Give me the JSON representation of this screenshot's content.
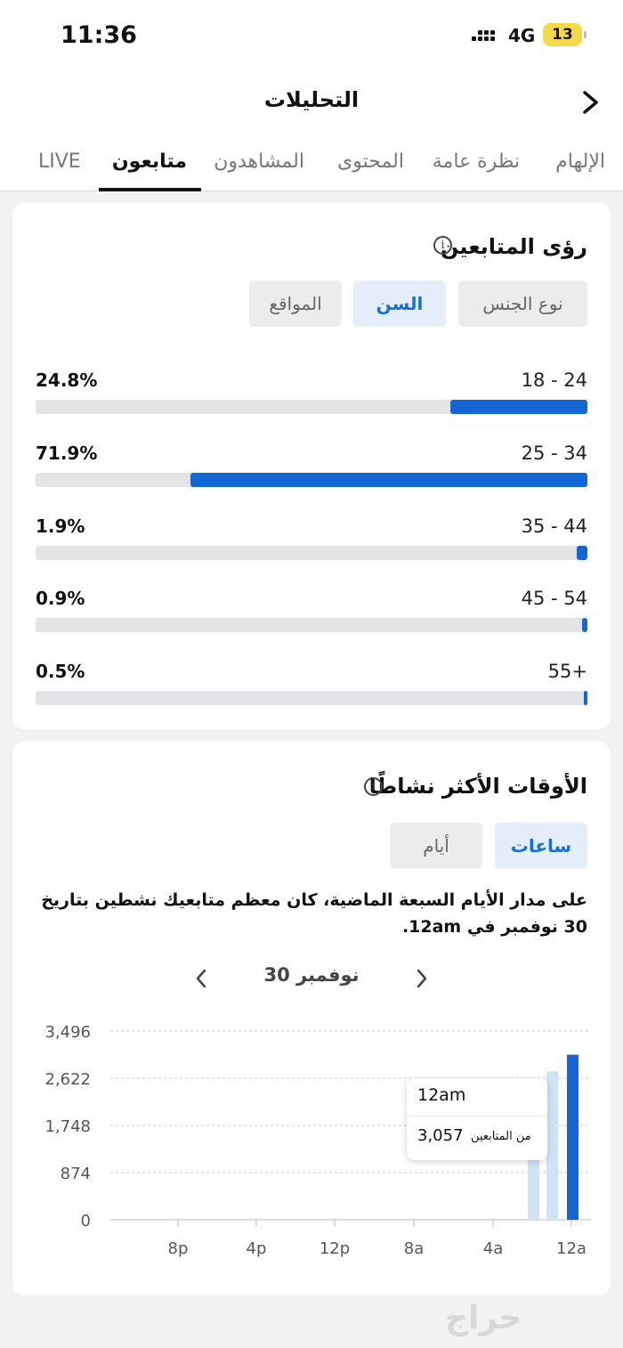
{
  "status_bar": {
    "time": "11:36",
    "network": "4G",
    "battery": "13"
  },
  "header": {
    "title": "التحليلات"
  },
  "tabs": [
    {
      "label": "الإلهام"
    },
    {
      "label": "نظرة عامة"
    },
    {
      "label": "المحتوى"
    },
    {
      "label": "المشاهدون"
    },
    {
      "label": "متابعون",
      "active": true
    },
    {
      "label": "LIVE"
    }
  ],
  "insights": {
    "title": "رؤى المتابعين",
    "info_icon": "i",
    "segments": [
      {
        "label": "نوع الجنس"
      },
      {
        "label": "السن",
        "active": true
      },
      {
        "label": "المواقع"
      }
    ],
    "age_groups": [
      {
        "range": "18 - 24",
        "percent": "24.8%",
        "value": 24.8
      },
      {
        "range": "25 - 34",
        "percent": "71.9%",
        "value": 71.9
      },
      {
        "range": "35 - 44",
        "percent": "1.9%",
        "value": 1.9
      },
      {
        "range": "45 - 54",
        "percent": "0.9%",
        "value": 0.9
      },
      {
        "range": "55+",
        "percent": "0.5%",
        "value": 0.5
      }
    ],
    "bar_color": "#1466d4"
  },
  "active_times": {
    "title": "الأوقات الأكثر نشاطًا",
    "info_icon": "i",
    "segments": [
      {
        "label": "ساعات",
        "active": true
      },
      {
        "label": "أيام"
      }
    ],
    "description": "على مدار الأيام السبعة الماضية، كان معظم متابعيك نشطين بتاريخ 30 نوفمبر في 12am.",
    "date_label": "30 نوفمبر",
    "tooltip": {
      "time": "12am",
      "value": "3,057",
      "label": "من المتابعين"
    }
  },
  "chart_data": {
    "type": "bar",
    "yticks": [
      "3,496",
      "2,622",
      "1,748",
      "874",
      "0"
    ],
    "ylim": [
      0,
      3496
    ],
    "xticks": [
      "8p",
      "4p",
      "12p",
      "8a",
      "4a",
      "12a"
    ],
    "bars": [
      {
        "value": 1150,
        "highlight": false
      },
      {
        "value": 2750,
        "highlight": false
      },
      {
        "value": 3057,
        "highlight": true
      }
    ],
    "colors": {
      "highlight": "#1466d4",
      "muted": "#cfe2f6",
      "grid": "#c8c8c8",
      "axis": "#555"
    }
  },
  "watermark": "حراج"
}
